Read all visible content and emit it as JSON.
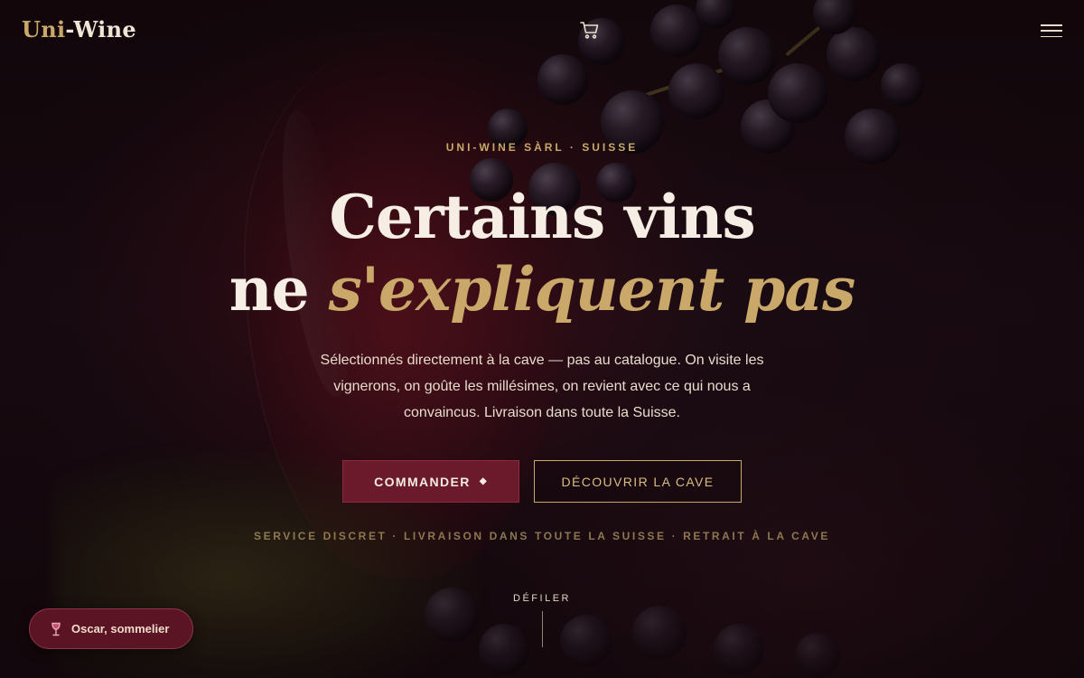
{
  "brand": {
    "part1": "Uni",
    "part2": "-Wine"
  },
  "header": {
    "cart_icon": "shopping-cart-icon",
    "menu_icon": "hamburger-menu-icon"
  },
  "hero": {
    "eyebrow": "UNI-WINE SÀRL · SUISSE",
    "title_line1": "Certains vins",
    "title_line2_plain": "ne ",
    "title_line2_accent": "s'expliquent pas",
    "lead": "Sélectionnés directement à la cave — pas au catalogue. On visite les vignerons, on goûte les millésimes, on revient avec ce qui nous a convaincus. Livraison dans toute la Suisse.",
    "primary_button": "COMMANDER",
    "primary_button_glyph": "◆",
    "secondary_button": "DÉCOUVRIR LA CAVE",
    "trust_line": "SERVICE DISCRET · LIVRAISON DANS TOUTE LA SUISSE · RETRAIT À LA CAVE"
  },
  "scroll": {
    "label": "DÉFILER"
  },
  "chat": {
    "label": "Oscar, sommelier",
    "icon": "wine-glass-icon"
  },
  "colors": {
    "accent_gold": "#c9a86a",
    "primary_wine": "#6b1a2c",
    "background": "#1a0a0e",
    "text_light": "#f6eee5"
  }
}
